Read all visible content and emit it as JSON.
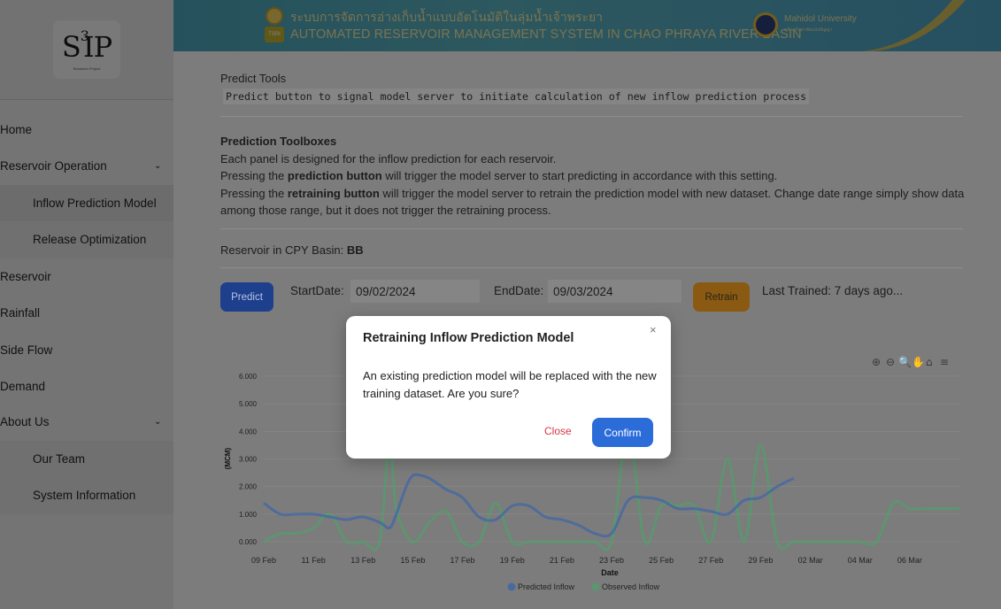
{
  "header": {
    "title_thai": "ระบบการจัดการอ่างเก็บน้ำแบบอัตโนมัติในลุ่มน้ำเจ้าพระยา",
    "title_en": "AUTOMATED RESERVOIR MANAGEMENT SYSTEM IN CHAO PHRAYA RIVER BASIN",
    "university": "Mahidol University",
    "university_sub": "มหิดลวิทยาลัยแห่งปัญญา",
    "emblem_text": "TSRI"
  },
  "logo": {
    "text": "S",
    "sup": "3",
    "rest": "IP",
    "sub": "Research Project"
  },
  "sidebar": {
    "items": [
      {
        "label": "Home"
      },
      {
        "label": "Reservoir Operation"
      },
      {
        "label": "Inflow Prediction Model"
      },
      {
        "label": "Release Optimization"
      },
      {
        "label": "Reservoir"
      },
      {
        "label": "Rainfall"
      },
      {
        "label": "Side Flow"
      },
      {
        "label": "Demand"
      },
      {
        "label": "About Us"
      },
      {
        "label": "Our Team"
      },
      {
        "label": "System Information"
      }
    ]
  },
  "main": {
    "predict_tools_title": "Predict Tools",
    "predict_tools_code": "Predict button to signal model server to initiate calculation of new inflow prediction process",
    "toolboxes_title": "Prediction Toolboxes",
    "toolboxes_line1": "Each panel is designed for the inflow prediction for each reservoir.",
    "toolboxes_line2_pre": "Pressing the ",
    "toolboxes_line2_bold": "prediction button",
    "toolboxes_line2_post": " will trigger the model server to start predicting in accordance with this setting.",
    "toolboxes_line3_pre": "Pressing the ",
    "toolboxes_line3_bold": "retraining button",
    "toolboxes_line3_post": " will trigger the model server to retrain the prediction model with new dataset. Change date range simply show data among those range, but it does not trigger the retraining process.",
    "basin_label": "Reservoir in CPY Basin: ",
    "basin_value": "BB",
    "predict_label": "Predict",
    "start_label": "StartDate:",
    "start_value": "09/02/2024",
    "end_label": "EndDate:",
    "end_value": "09/03/2024",
    "retrain_label": "Retrain",
    "last_trained": "Last Trained: 7 days ago..."
  },
  "modal": {
    "title": "Retraining Inflow Prediction Model",
    "close_icon": "×",
    "body": "An existing prediction model will be replaced with the new training dataset. Are you sure?",
    "cancel_label": "Close",
    "confirm_label": "Confirm"
  },
  "chart_data": {
    "type": "line",
    "xlabel": "Date",
    "ylabel": "(MCM)",
    "ylim": [
      0,
      6
    ],
    "yticks": [
      "0.000",
      "1.000",
      "2.000",
      "3.000",
      "4.000",
      "5.000",
      "6.000"
    ],
    "xticks": [
      "09 Feb",
      "11 Feb",
      "13 Feb",
      "15 Feb",
      "17 Feb",
      "19 Feb",
      "21 Feb",
      "23 Feb",
      "25 Feb",
      "27 Feb",
      "29 Feb",
      "02 Mar",
      "04 Mar",
      "06 Mar"
    ],
    "series": [
      {
        "name": "Predicted Inflow",
        "color": "#2a5fb5",
        "x": [
          0,
          1,
          2,
          3,
          4,
          5,
          6,
          7,
          7.6,
          8,
          8.6,
          9,
          9.5,
          10,
          11,
          12,
          13,
          14,
          15,
          16,
          17,
          18,
          19,
          20,
          21,
          22,
          23,
          24,
          25,
          26,
          27,
          28,
          29,
          30,
          31,
          32
        ],
        "y": [
          1.4,
          1.0,
          1.0,
          1.0,
          0.9,
          0.8,
          0.9,
          0.7,
          0.5,
          1.0,
          2.0,
          2.4,
          2.4,
          2.3,
          1.9,
          1.6,
          0.9,
          0.8,
          1.3,
          1.3,
          0.9,
          0.8,
          0.6,
          0.3,
          0.3,
          1.5,
          1.6,
          1.5,
          1.2,
          1.2,
          1.1,
          1.0,
          1.5,
          1.6,
          2.0,
          2.3
        ]
      },
      {
        "name": "Observed Inflow",
        "color": "#45a866",
        "x": [
          0,
          1,
          2,
          3,
          4,
          5,
          6,
          7,
          7.6,
          8,
          9,
          10,
          11,
          12,
          13,
          14,
          15,
          16,
          17,
          18,
          19,
          20,
          21,
          22,
          23,
          24,
          25,
          26,
          27,
          28,
          29,
          30,
          31,
          32,
          33,
          34,
          35,
          36,
          37,
          38,
          39,
          40,
          41,
          42
        ],
        "y": [
          0.0,
          0.3,
          0.3,
          0.5,
          1.0,
          0.0,
          0.0,
          0.0,
          3.9,
          1.2,
          0.0,
          0.7,
          1.1,
          0.0,
          0.0,
          1.4,
          0.0,
          0.0,
          0.0,
          0.0,
          0.0,
          0.0,
          0.0,
          4.0,
          0.0,
          1.3,
          1.3,
          1.3,
          0.0,
          3.0,
          0.0,
          3.5,
          0.0,
          0.0,
          0.0,
          0.0,
          0.0,
          0.0,
          0.0,
          1.4,
          1.2,
          1.2,
          1.2,
          1.2
        ]
      }
    ],
    "legend": "bottom-center",
    "toolbar_icons": [
      "zoom-in-icon",
      "zoom-out-icon",
      "magnify-icon",
      "pan-hand-icon",
      "home-icon",
      "menu-icon"
    ]
  }
}
